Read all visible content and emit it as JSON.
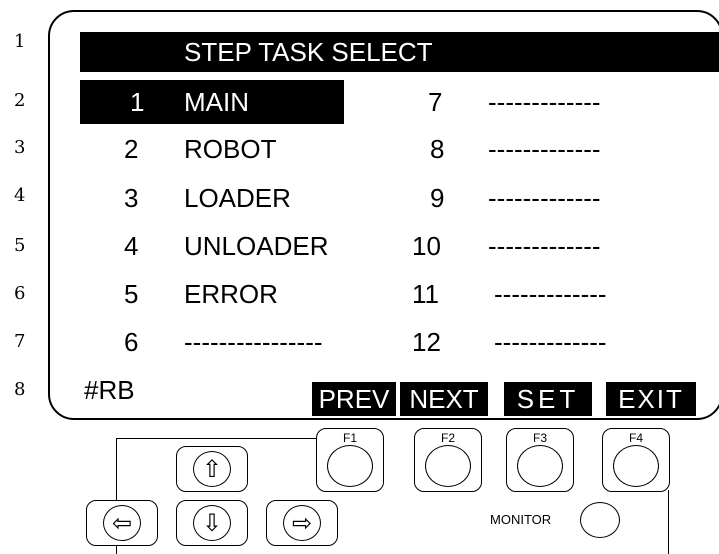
{
  "line_numbers": [
    "1",
    "2",
    "3",
    "4",
    "5",
    "6",
    "7",
    "8"
  ],
  "title": "STEP  TASK  SELECT",
  "left_items": [
    {
      "num": "1",
      "label": "MAIN"
    },
    {
      "num": "2",
      "label": "ROBOT"
    },
    {
      "num": "3",
      "label": "LOADER"
    },
    {
      "num": "4",
      "label": "UNLOADER"
    },
    {
      "num": "5",
      "label": "ERROR"
    },
    {
      "num": "6",
      "label": "----------------"
    }
  ],
  "right_items": [
    {
      "num": "7",
      "label": "-------------"
    },
    {
      "num": "8",
      "label": "-------------"
    },
    {
      "num": "9",
      "label": "-------------"
    },
    {
      "num": "10",
      "label": "-------------"
    },
    {
      "num": "11",
      "label": "-------------"
    },
    {
      "num": "12",
      "label": "-------------"
    }
  ],
  "status": "#RB",
  "soft_keys": {
    "f1": "PREV",
    "f2": "NEXT",
    "f3": "SET",
    "f4": "EXIT"
  },
  "hw_buttons": {
    "f1": "F1",
    "f2": "F2",
    "f3": "F3",
    "f4": "F4",
    "monitor": "MONITOR"
  },
  "arrow_icons": {
    "up": "⇧",
    "down": "⇩",
    "left": "⇦",
    "right": "⇨"
  }
}
